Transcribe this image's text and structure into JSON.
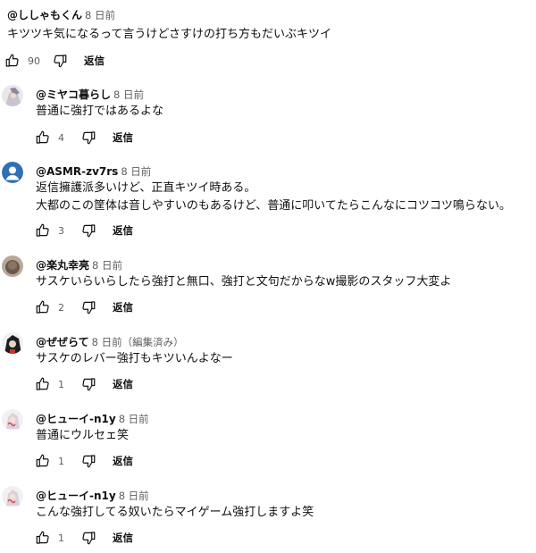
{
  "top_comment": {
    "author": "@ししゃもくん",
    "time": "8 日前",
    "text": "キツツキ気になるって言うけどさすけの打ち方もだいぶキツイ",
    "likes": "90",
    "reply_label": "返信"
  },
  "replies": [
    {
      "author": "@ミヤコ暮らし",
      "time": "8 日前",
      "edited": "",
      "lines": [
        "普通に強打ではあるよな"
      ],
      "likes": "4",
      "reply_label": "返信",
      "avatar": "anime-illustration"
    },
    {
      "author": "@ASMR-zv7rs",
      "time": "8 日前",
      "edited": "",
      "lines": [
        "返信擁護派多いけど、正直キツイ時ある。",
        "大都のこの筐体は音しやすいのもあるけど、普通に叩いてたらこんなにコツコツ鳴らない。"
      ],
      "likes": "3",
      "reply_label": "返信",
      "avatar": "default-person"
    },
    {
      "author": "@楽丸幸亮",
      "time": "8 日前",
      "edited": "",
      "lines": [
        "サスケいらいらしたら強打と無口、強打と文句だからなw撮影のスタッフ大変よ"
      ],
      "likes": "2",
      "reply_label": "返信",
      "avatar": "photo-dark"
    },
    {
      "author": "@ぜぜらて",
      "time": "8 日前",
      "edited": "（編集済み）",
      "lines": [
        "サスケのレバー強打もキツいんよなー"
      ],
      "likes": "1",
      "reply_label": "返信",
      "avatar": "character-dark"
    },
    {
      "author": "@ヒューイ-n1y",
      "time": "8 日前",
      "edited": "",
      "lines": [
        "普通にウルセェ笑"
      ],
      "likes": "1",
      "reply_label": "返信",
      "avatar": "anime-illustration-red"
    },
    {
      "author": "@ヒューイ-n1y",
      "time": "8 日前",
      "edited": "",
      "lines": [
        "こんな強打してる奴いたらマイゲーム強打しますよ笑"
      ],
      "likes": "1",
      "reply_label": "返信",
      "avatar": "anime-illustration-red"
    }
  ],
  "colors": {
    "text_primary": "#0f0f0f",
    "text_secondary": "#606060",
    "default_avatar": "#2f6fb5"
  }
}
